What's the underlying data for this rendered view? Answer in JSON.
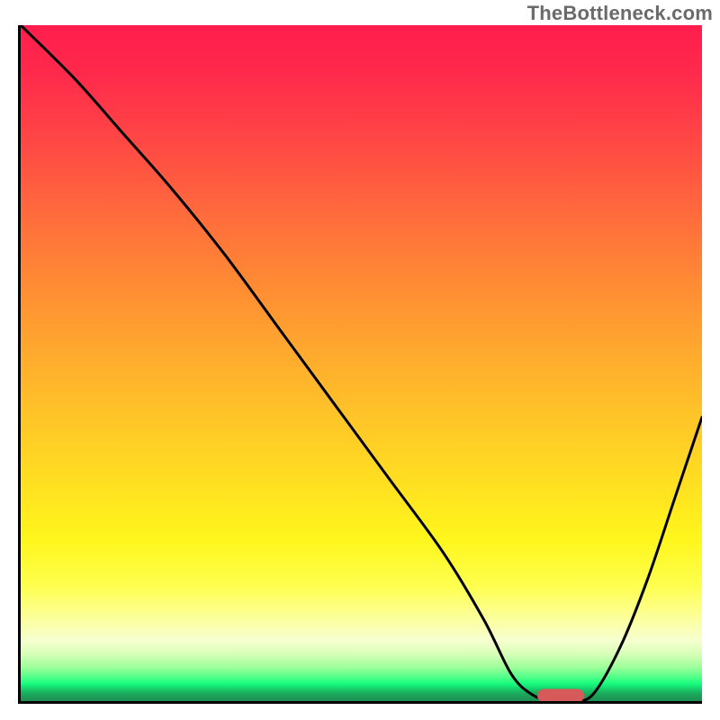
{
  "watermark": "TheBottleneck.com",
  "chart_data": {
    "type": "line",
    "title": "",
    "xlabel": "",
    "ylabel": "",
    "xlim": [
      0,
      100
    ],
    "ylim": [
      0,
      100
    ],
    "grid": false,
    "legend": false,
    "gradient_stops": [
      {
        "pos": 0,
        "color": "#ff1d4d"
      },
      {
        "pos": 18,
        "color": "#ff4a44"
      },
      {
        "pos": 38,
        "color": "#ff8a34"
      },
      {
        "pos": 58,
        "color": "#ffc528"
      },
      {
        "pos": 76,
        "color": "#fff61c"
      },
      {
        "pos": 91,
        "color": "#f6ffd0"
      },
      {
        "pos": 96.5,
        "color": "#4eff88"
      },
      {
        "pos": 100,
        "color": "#1f8c50"
      }
    ],
    "series": [
      {
        "name": "bottleneck-curve",
        "color": "#000000",
        "x": [
          0,
          8,
          15,
          22,
          30,
          38,
          46,
          54,
          62,
          68,
          72,
          75,
          78,
          81,
          84,
          88,
          92,
          96,
          100
        ],
        "y": [
          100,
          92,
          84,
          76,
          66,
          55,
          44,
          33,
          22,
          12,
          4,
          1,
          0,
          0,
          1,
          8,
          18,
          30,
          42
        ]
      }
    ],
    "marker": {
      "name": "optimal-range",
      "x": 79,
      "y": 1.2,
      "color": "#d75a5a"
    }
  }
}
